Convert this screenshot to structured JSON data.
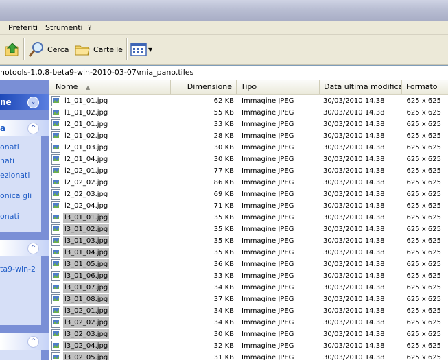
{
  "menu": [
    "Preferiti",
    "Strumenti",
    "?"
  ],
  "toolbar": {
    "search_label": "Cerca",
    "folders_label": "Cartelle"
  },
  "address": "notools-1.0.8-beta9-win-2010-03-07\\mia_pano.tiles",
  "left_pane": {
    "panel1_title": "ne",
    "panel2_title": "a",
    "panel2_items": [
      "onati",
      "nati",
      "ezionati",
      "onica gli",
      "onati"
    ],
    "panel4_items": [
      "ta9-win-2"
    ]
  },
  "columns": [
    "Nome",
    "Dimensione",
    "Tipo",
    "Data ultima modifica",
    "Formato"
  ],
  "files": [
    {
      "name": "l1_01_01.jpg",
      "size": "62 KB",
      "type": "Immagine JPEG",
      "date": "30/03/2010 14.38",
      "format": "625 x 625",
      "selected": false
    },
    {
      "name": "l1_01_02.jpg",
      "size": "55 KB",
      "type": "Immagine JPEG",
      "date": "30/03/2010 14.38",
      "format": "625 x 625",
      "selected": false
    },
    {
      "name": "l2_01_01.jpg",
      "size": "33 KB",
      "type": "Immagine JPEG",
      "date": "30/03/2010 14.38",
      "format": "625 x 625",
      "selected": false
    },
    {
      "name": "l2_01_02.jpg",
      "size": "28 KB",
      "type": "Immagine JPEG",
      "date": "30/03/2010 14.38",
      "format": "625 x 625",
      "selected": false
    },
    {
      "name": "l2_01_03.jpg",
      "size": "30 KB",
      "type": "Immagine JPEG",
      "date": "30/03/2010 14.38",
      "format": "625 x 625",
      "selected": false
    },
    {
      "name": "l2_01_04.jpg",
      "size": "30 KB",
      "type": "Immagine JPEG",
      "date": "30/03/2010 14.38",
      "format": "625 x 625",
      "selected": false
    },
    {
      "name": "l2_02_01.jpg",
      "size": "77 KB",
      "type": "Immagine JPEG",
      "date": "30/03/2010 14.38",
      "format": "625 x 625",
      "selected": false
    },
    {
      "name": "l2_02_02.jpg",
      "size": "86 KB",
      "type": "Immagine JPEG",
      "date": "30/03/2010 14.38",
      "format": "625 x 625",
      "selected": false
    },
    {
      "name": "l2_02_03.jpg",
      "size": "69 KB",
      "type": "Immagine JPEG",
      "date": "30/03/2010 14.38",
      "format": "625 x 625",
      "selected": false
    },
    {
      "name": "l2_02_04.jpg",
      "size": "71 KB",
      "type": "Immagine JPEG",
      "date": "30/03/2010 14.38",
      "format": "625 x 625",
      "selected": false
    },
    {
      "name": "l3_01_01.jpg",
      "size": "35 KB",
      "type": "Immagine JPEG",
      "date": "30/03/2010 14.38",
      "format": "625 x 625",
      "selected": true
    },
    {
      "name": "l3_01_02.jpg",
      "size": "35 KB",
      "type": "Immagine JPEG",
      "date": "30/03/2010 14.38",
      "format": "625 x 625",
      "selected": true
    },
    {
      "name": "l3_01_03.jpg",
      "size": "35 KB",
      "type": "Immagine JPEG",
      "date": "30/03/2010 14.38",
      "format": "625 x 625",
      "selected": true
    },
    {
      "name": "l3_01_04.jpg",
      "size": "35 KB",
      "type": "Immagine JPEG",
      "date": "30/03/2010 14.38",
      "format": "625 x 625",
      "selected": true
    },
    {
      "name": "l3_01_05.jpg",
      "size": "36 KB",
      "type": "Immagine JPEG",
      "date": "30/03/2010 14.38",
      "format": "625 x 625",
      "selected": true
    },
    {
      "name": "l3_01_06.jpg",
      "size": "33 KB",
      "type": "Immagine JPEG",
      "date": "30/03/2010 14.38",
      "format": "625 x 625",
      "selected": true
    },
    {
      "name": "l3_01_07.jpg",
      "size": "34 KB",
      "type": "Immagine JPEG",
      "date": "30/03/2010 14.38",
      "format": "625 x 625",
      "selected": true
    },
    {
      "name": "l3_01_08.jpg",
      "size": "37 KB",
      "type": "Immagine JPEG",
      "date": "30/03/2010 14.38",
      "format": "625 x 625",
      "selected": true
    },
    {
      "name": "l3_02_01.jpg",
      "size": "34 KB",
      "type": "Immagine JPEG",
      "date": "30/03/2010 14.38",
      "format": "625 x 625",
      "selected": true
    },
    {
      "name": "l3_02_02.jpg",
      "size": "34 KB",
      "type": "Immagine JPEG",
      "date": "30/03/2010 14.38",
      "format": "625 x 625",
      "selected": true
    },
    {
      "name": "l3_02_03.jpg",
      "size": "30 KB",
      "type": "Immagine JPEG",
      "date": "30/03/2010 14.38",
      "format": "625 x 625",
      "selected": true
    },
    {
      "name": "l3_02_04.jpg",
      "size": "32 KB",
      "type": "Immagine JPEG",
      "date": "30/03/2010 14.38",
      "format": "625 x 625",
      "selected": true
    },
    {
      "name": "l3_02_05.jpg",
      "size": "31 KB",
      "type": "Immagine JPEG",
      "date": "30/03/2010 14.38",
      "format": "625 x 625",
      "selected": true
    }
  ]
}
